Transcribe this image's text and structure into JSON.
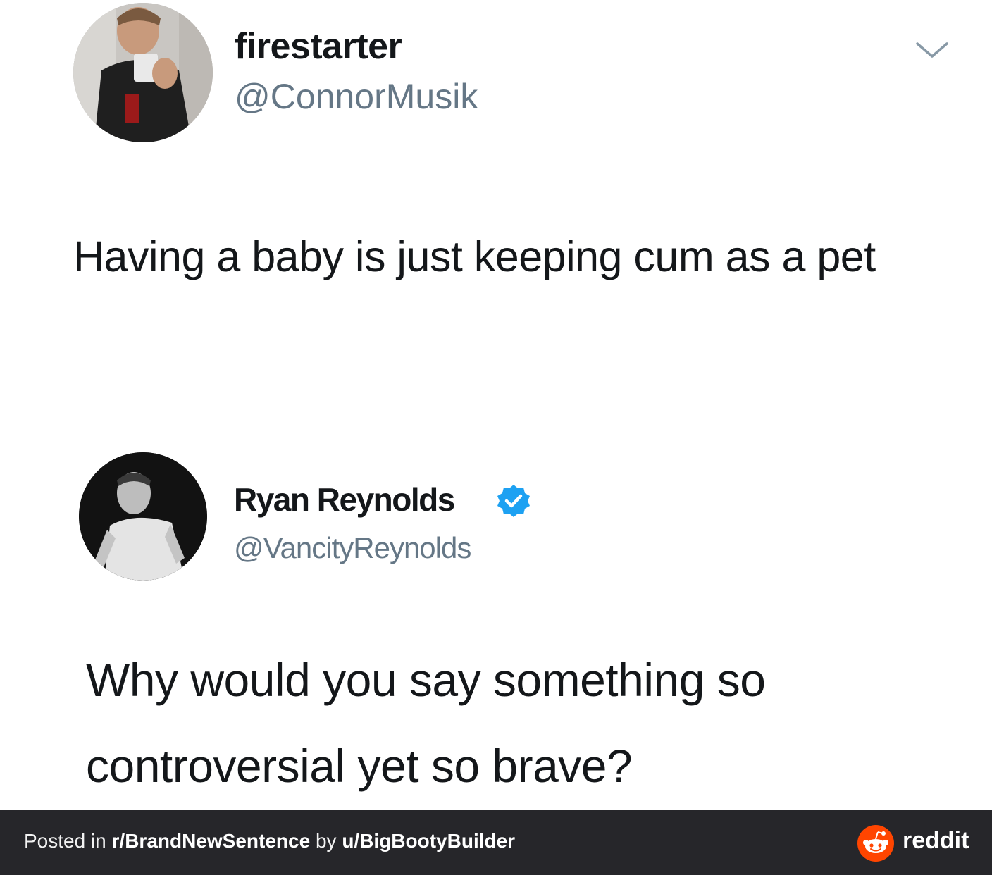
{
  "tweets": [
    {
      "display_name": "firestarter",
      "handle": "@ConnorMusik",
      "text": "Having a baby is just keeping cum as a pet",
      "avatar_icon": "user-avatar-photo",
      "menu_icon": "chevron-down-icon"
    },
    {
      "display_name": "Ryan Reynolds",
      "handle": "@VancityReynolds",
      "verified": true,
      "verified_icon": "verified-badge-icon",
      "text": "Why would you say something so controversial yet so brave?",
      "avatar_icon": "user-avatar-photo"
    }
  ],
  "footer": {
    "posted_in_prefix": "Posted in ",
    "subreddit": "r/BrandNewSentence",
    "by_text": " by ",
    "username": "u/BigBootyBuilder",
    "brand": "reddit",
    "brand_icon": "reddit-alien-icon"
  },
  "colors": {
    "verified_blue": "#1da1f2",
    "reddit_orange": "#ff4500",
    "footer_bg": "#26262a",
    "handle_gray": "#657786"
  }
}
